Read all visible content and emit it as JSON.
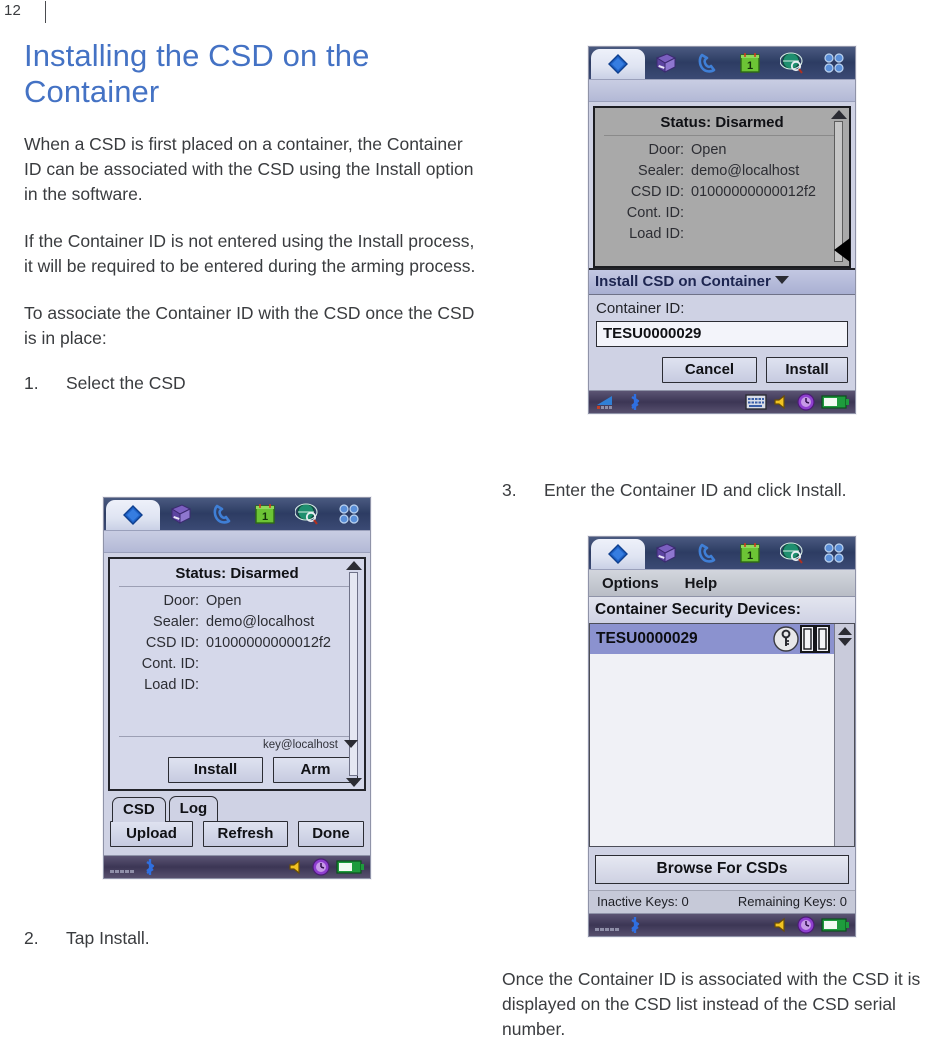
{
  "page": {
    "folio": "12"
  },
  "article": {
    "heading": "Installing the CSD on the Container",
    "para1": "When a CSD is first placed on a container, the Container ID can be associated with the CSD using the Install option in the software.",
    "para2": "If the Container ID is not entered using the Install process, it will be required to be entered during the arming process.",
    "para3": "To associate the Container ID with the CSD once the CSD is in place:",
    "step1_num": "1.",
    "step1_text": "Select the CSD",
    "step2_num": "2.",
    "step2_text": "Tap Install.",
    "step3_num": "3.",
    "step3_text": "Enter the Container ID and click Install.",
    "closing": "Once the Container ID is associated with the CSD it is displayed on the CSD list instead of the CSD serial number."
  },
  "toolbar": {
    "icons": [
      "blue-diamond-icon",
      "purple-book-icon",
      "phone-handset-icon",
      "calendar-icon",
      "globe-search-icon",
      "grid-apps-icon"
    ],
    "calendar_day": "1"
  },
  "statusbar": {
    "icons": [
      "signal-icon",
      "bluetooth-icon",
      "keyboard-icon",
      "speaker-icon",
      "clock-icon",
      "battery-icon"
    ]
  },
  "screen1": {
    "caption": "Select the CSD",
    "status_title": "Status: Disarmed",
    "rows": [
      {
        "label": "Door:",
        "value": "Open"
      },
      {
        "label": "Sealer:",
        "value": "demo@localhost"
      },
      {
        "label": "CSD ID:",
        "value": "01000000000012f2"
      },
      {
        "label": "Cont. ID:",
        "value": ""
      },
      {
        "label": "Load ID:",
        "value": ""
      }
    ],
    "key_label": "key@localhost",
    "install_label": "Install",
    "arm_label": "Arm",
    "tab_csd": "CSD",
    "tab_log": "Log",
    "upload_label": "Upload",
    "refresh_label": "Refresh",
    "done_label": "Done"
  },
  "screen2": {
    "status_title": "Status: Disarmed",
    "rows": [
      {
        "label": "Door:",
        "value": "Open"
      },
      {
        "label": "Sealer:",
        "value": "demo@localhost"
      },
      {
        "label": "CSD ID:",
        "value": "01000000000012f2"
      },
      {
        "label": "Cont. ID:",
        "value": ""
      },
      {
        "label": "Load ID:",
        "value": ""
      }
    ],
    "dialog_title": "Install CSD on Container",
    "field_label": "Container ID:",
    "field_value": "TESU0000029",
    "cancel_label": "Cancel",
    "install_label": "Install"
  },
  "screen3": {
    "menu_options": "Options",
    "menu_help": "Help",
    "list_header": "Container Security Devices:",
    "list_item": "TESU0000029",
    "item_icons": [
      "key-icon",
      "open-door-icon"
    ],
    "browse_label": "Browse For CSDs",
    "inactive_keys": "Inactive Keys: 0",
    "remaining_keys": "Remaining Keys: 0"
  },
  "colors": {
    "heading": "#4472c4",
    "body_text": "#3a3c3f",
    "device_chrome": "#cfd2e4",
    "selection": "#8b92cf",
    "greyed_panel": "#a9a9a9"
  }
}
